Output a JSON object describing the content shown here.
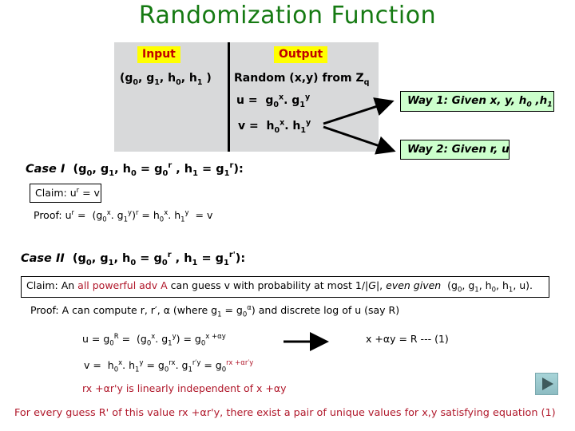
{
  "slide": {
    "title": "Randomization Function",
    "input_label": "Input",
    "output_label": "Output",
    "input_value": "(g0, g1, h0, h1 )",
    "output_random": "Random (x,y) from Zq",
    "u_def": "u = g0^x. g1^y",
    "v_def": "v = h0^x. h1^y",
    "way1": "Way 1: Given x, y, h0 ,h1",
    "way2": "Way 2: Given r, u",
    "case1": {
      "heading": "Case I (g0, g1, h0 = g0^r , h1 = g1^r):",
      "claim": "Claim: u^r = v",
      "proof": "Proof: u^r = (g0^x. g1^y)^r = h0^x. h1^y = v"
    },
    "case2": {
      "heading": "Case II (g0, g1, h0 = g0^r , h1 = g1^r'):",
      "claim_prefix": "Claim: An ",
      "claim_highlight": "all powerful adv A",
      "claim_suffix": " can guess v with probability at most 1/|G|, even given (g0, g1, h0, h1, u).",
      "proof": "Proof: A can compute r, r', α (where g1 = g0^α) and discrete log of u (say R)",
      "u_eq": "u = g0^R = (g0^x. g1^y) = g0^(x +αy)",
      "eq1": "x +αy = R --- (1)",
      "v_eq": "v = h0^x. h1^y = g0^rx. g1^r'y = g0^(rx +αr'y)",
      "independent": "rx +αr'y is linearly independent of x +αy",
      "conclusion": "For every guess R' of this value rx +αr'y, there exist a pair of unique values for x,y satisfying equation (1)"
    },
    "play_button_icon": "play-icon",
    "colors": {
      "title": "#157a12",
      "panel": "#d8d9da",
      "label_bg": "#ffff00",
      "label_text": "#c00000",
      "way_box": "#ccffcc",
      "highlight": "#b0172a"
    }
  }
}
